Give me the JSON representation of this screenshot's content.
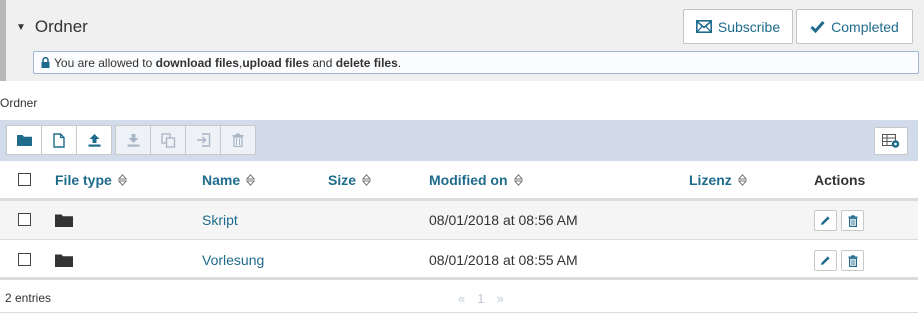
{
  "panel": {
    "title": "Ordner",
    "subscribe_label": "Subscribe",
    "completed_label": "Completed",
    "info_prefix": "You are allowed to ",
    "perm1": "download files",
    "sep1": ", ",
    "perm2": "upload files",
    "sep2": " and ",
    "perm3": "delete files",
    "info_suffix": "."
  },
  "section_label": "Ordner",
  "toolbar": {
    "icons": [
      "folder-icon",
      "new-file-icon",
      "upload-icon",
      "download-icon",
      "copy-icon",
      "move-icon",
      "delete-icon",
      "table-settings-icon"
    ]
  },
  "table": {
    "columns": [
      "File type",
      "Name",
      "Size",
      "Modified on",
      "Lizenz",
      "Actions"
    ],
    "rows": [
      {
        "type": "folder",
        "name": "Skript",
        "size": "",
        "modified": "08/01/2018 at 08:56 AM",
        "license": ""
      },
      {
        "type": "folder",
        "name": "Vorlesung",
        "size": "",
        "modified": "08/01/2018 at 08:55 AM",
        "license": ""
      }
    ]
  },
  "footer": {
    "entries": "2 entries",
    "prev": "«",
    "page": "1",
    "next": "»"
  },
  "colors": {
    "accent": "#1f6b8c",
    "toolbar_bg": "#d1dbe9",
    "panel_bg": "#f0f0f0"
  }
}
